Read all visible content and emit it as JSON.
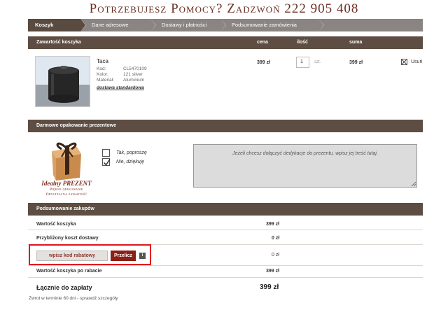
{
  "header": {
    "help_text": "Potrzebujesz Pomocy? Zadzwoń  222 905 408"
  },
  "steps": [
    {
      "label": "Koszyk",
      "active": true
    },
    {
      "label": "Dane adresowe",
      "active": false
    },
    {
      "label": "Dostawy i płatności",
      "active": false
    },
    {
      "label": "Podsumowanie zamówienia",
      "active": false
    }
  ],
  "cart": {
    "title": "Zawartość koszyka",
    "col_price": "cena",
    "col_qty": "ilość",
    "col_sum": "suma",
    "item": {
      "name": "Taca",
      "code_label": "Kod:",
      "code": "CL5470109",
      "color_label": "Kolor:",
      "color": "121 silver",
      "material_label": "Materiał:",
      "material": "Aluminium",
      "delivery": "dostawa standardowa",
      "price": "399 zł",
      "qty": "1",
      "unit": "szt.",
      "sum": "399 zł",
      "remove": "Usuń"
    }
  },
  "gift": {
    "title": "Darmowe opakowanie prezentowe",
    "option_yes": "Tak, poproszę",
    "option_no": "Nie, dziękuję",
    "selected": "no",
    "logo_title": "Idealny PREZENT",
    "logo_line1": "Piękne opakowanie",
    "logo_line2": "Oryginalna zawartość",
    "dedication_placeholder": "Jeżeli chcesz dołączyć dedykacje do prezentu, wpisz jej treść tutaj."
  },
  "summary": {
    "title": "Podsumowanie zakupów",
    "cart_value_label": "Wartość koszyka",
    "cart_value": "399 zł",
    "shipping_label": "Przybliżony koszt dostawy",
    "shipping": "0 zł",
    "coupon_placeholder": "wpisz kod rabatowy",
    "calc_button": "Przelicz",
    "info_icon": "i",
    "discount": "0 zł",
    "after_discount_label": "Wartość koszyka po rabacie",
    "after_discount": "399 zł",
    "total_label": "Łącznie do zapłaty",
    "total": "399 zł",
    "return_note": "Zwrot w terminie 60 dni - sprawdź szczegóły"
  },
  "colors": {
    "bar": "#5d4d42",
    "accent": "#8c1f16",
    "highlight": "#e0141c",
    "header_text": "#6b2f22"
  },
  "icons": [
    "remove-x-icon",
    "checkbox-check-icon",
    "info-icon",
    "resize-grip-icon",
    "gift-box-icon"
  ]
}
